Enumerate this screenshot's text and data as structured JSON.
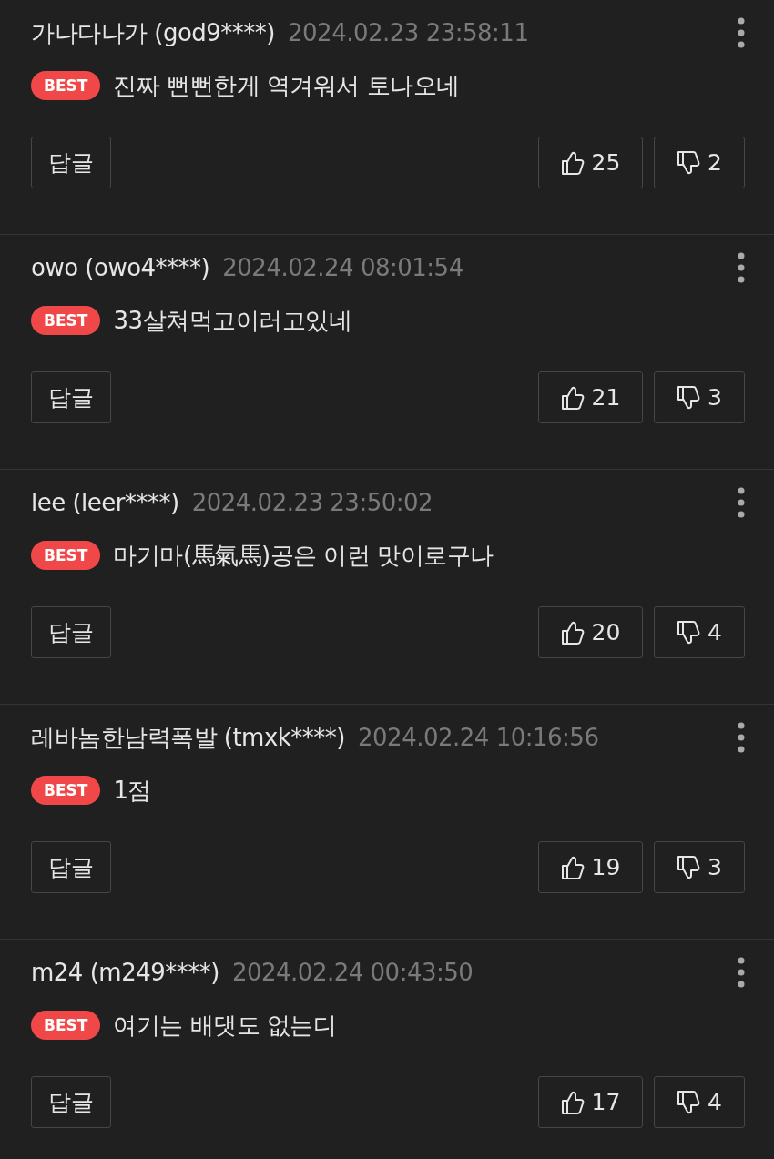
{
  "comments": [
    {
      "nickname": "가나다나가 (god9****)",
      "date": "2024.02.23 23:58:11",
      "badge": "BEST",
      "text": "진짜 뻔뻔한게 역겨워서 토나오네",
      "reply": "답글",
      "likes": "25",
      "dislikes": "2"
    },
    {
      "nickname": "owo (owo4****)",
      "date": "2024.02.24 08:01:54",
      "badge": "BEST",
      "text": "33살쳐먹고이러고있네",
      "reply": "답글",
      "likes": "21",
      "dislikes": "3"
    },
    {
      "nickname": "lee (leer****)",
      "date": "2024.02.23 23:50:02",
      "badge": "BEST",
      "text": "마기마(馬氣馬)공은 이런 맛이로구나",
      "reply": "답글",
      "likes": "20",
      "dislikes": "4"
    },
    {
      "nickname": "레바놈한남력폭발 (tmxk****)",
      "date": "2024.02.24 10:16:56",
      "badge": "BEST",
      "text": "1점",
      "reply": "답글",
      "likes": "19",
      "dislikes": "3"
    },
    {
      "nickname": "m24 (m249****)",
      "date": "2024.02.24 00:43:50",
      "badge": "BEST",
      "text": "여기는 배댓도 없는디",
      "reply": "답글",
      "likes": "17",
      "dislikes": "4"
    }
  ]
}
